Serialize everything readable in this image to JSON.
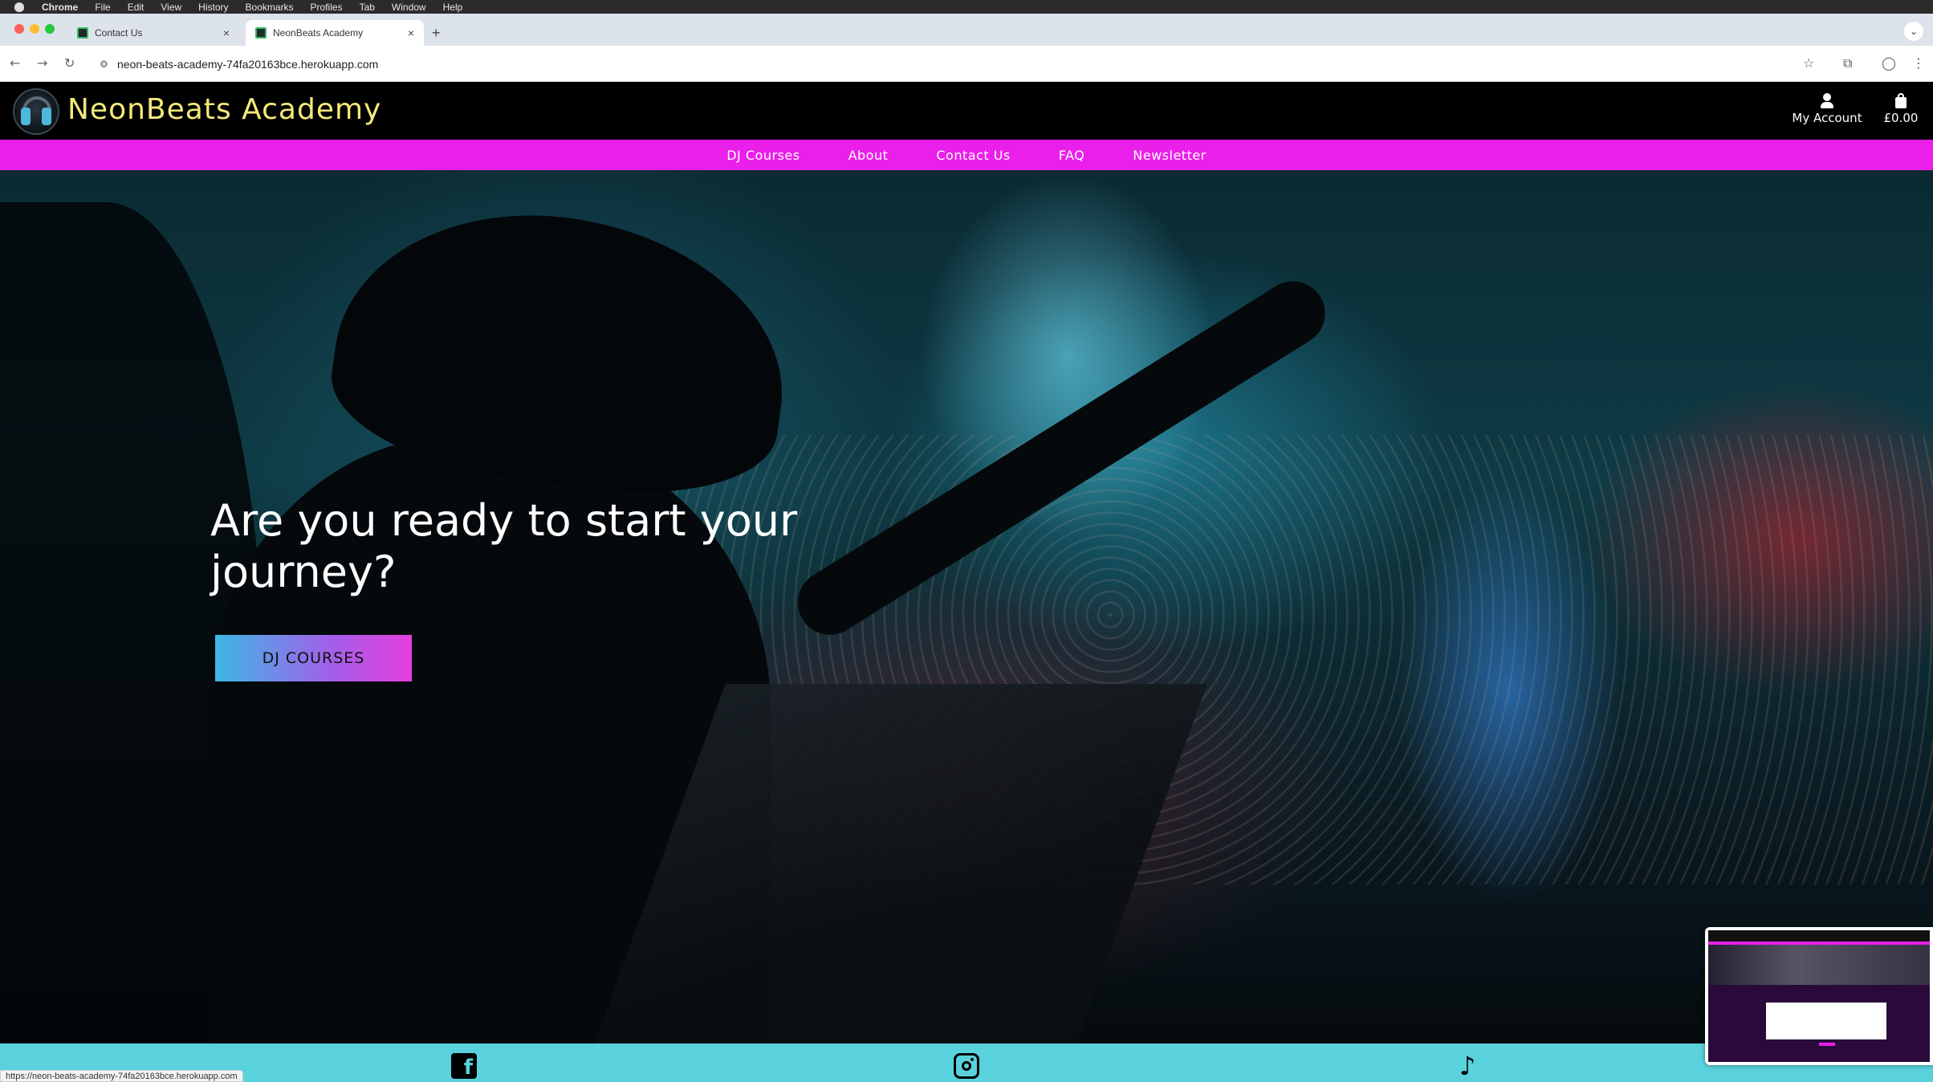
{
  "menubar": {
    "app": "Chrome",
    "items": [
      "File",
      "Edit",
      "View",
      "History",
      "Bookmarks",
      "Profiles",
      "Tab",
      "Window",
      "Help"
    ]
  },
  "browser": {
    "tabs": [
      {
        "title": "Contact Us",
        "active": false
      },
      {
        "title": "NeonBeats Academy",
        "active": true
      }
    ],
    "new_tab": "+",
    "url": "neon-beats-academy-74fa20163bce.herokuapp.com",
    "status_url": "https://neon-beats-academy-74fa20163bce.herokuapp.com"
  },
  "site": {
    "brand": "NeonBeats Academy",
    "account_label": "My Account",
    "cart_total": "£0.00",
    "nav": [
      "DJ Courses",
      "About",
      "Contact Us",
      "FAQ",
      "Newsletter"
    ],
    "hero": {
      "title": "Are you ready to start your journey?",
      "button": "DJ COURSES"
    },
    "footer_icons": [
      "facebook-icon",
      "instagram-icon",
      "tiktok-icon"
    ]
  },
  "colors": {
    "brand_yellow": "#f5e97a",
    "nav_magenta": "#ea1fea",
    "footer_cyan": "#5ad2de"
  }
}
